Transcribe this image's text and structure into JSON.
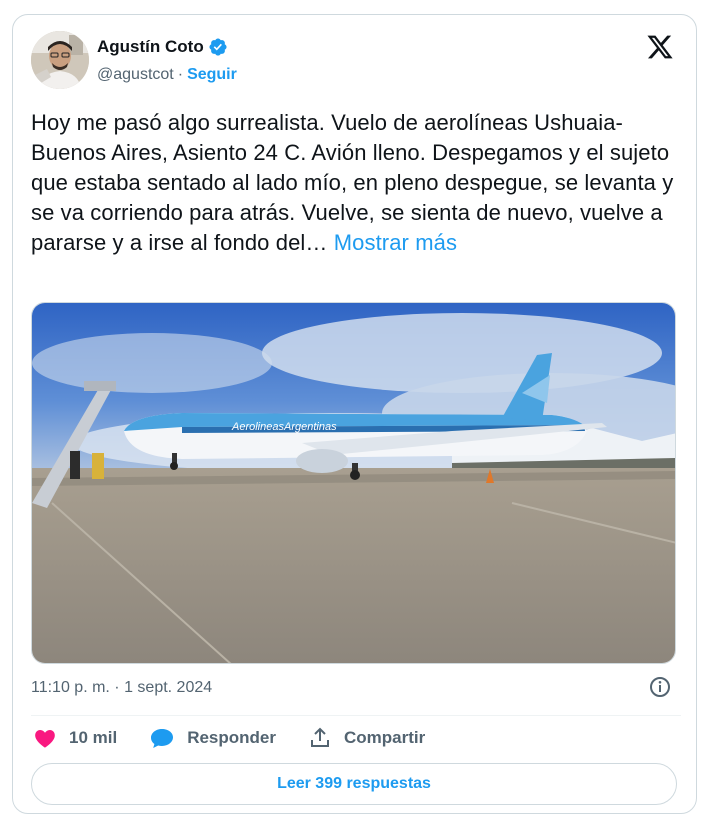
{
  "author": {
    "name": "Agustín Coto",
    "handle": "@agustcot",
    "separator": "·",
    "follow_label": "Seguir"
  },
  "tweet": {
    "text": "Hoy me pasó algo surrealista. Vuelo de aerolíneas Ushuaia-Buenos Aires, Asiento 24 C. Avión lleno. Despegamos y el sujeto que estaba sentado al lado mío, en pleno despegue, se levanta y se va corriendo para atrás. Vuelve, se sienta de nuevo, vuelve a pararse y a irse al fondo del…",
    "show_more_label": "Mostrar más",
    "timestamp": "11:10 p. m. · 1 sept. 2024",
    "media_text": "AerolineasArgentinas"
  },
  "actions": {
    "likes_count": "10 mil",
    "reply_label": "Responder",
    "share_label": "Compartir"
  },
  "replies_button_label": "Leer 399 respuestas",
  "colors": {
    "accent": "#1d9bf0",
    "like": "#f91880",
    "muted": "#536471",
    "text": "#0f1419"
  },
  "icons": [
    "verified-badge-icon",
    "x-logo-icon",
    "info-icon",
    "heart-icon",
    "reply-bubble-icon",
    "share-icon"
  ]
}
